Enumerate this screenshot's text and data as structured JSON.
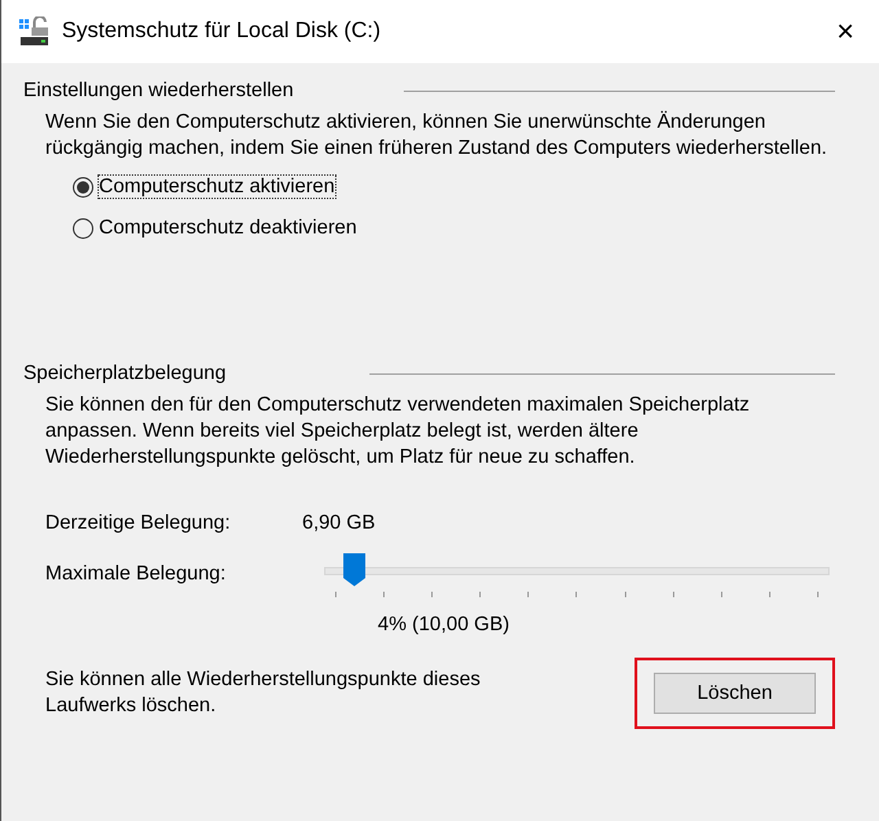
{
  "window": {
    "title": "Systemschutz für Local Disk (C:)",
    "close": "×"
  },
  "restore": {
    "heading": "Einstellungen wiederherstellen",
    "description": "Wenn Sie den Computerschutz aktivieren, können Sie unerwünschte Änderungen rückgängig machen, indem Sie einen früheren Zustand des Computers wiederherstellen.",
    "options": [
      {
        "label": "Computerschutz aktivieren",
        "selected": true
      },
      {
        "label": "Computerschutz deaktivieren",
        "selected": false
      }
    ]
  },
  "disk": {
    "heading": "Speicherplatzbelegung",
    "description": "Sie können den für den Computerschutz verwendeten maximalen Speicherplatz anpassen. Wenn bereits viel Speicherplatz belegt ist, werden ältere Wiederherstellungspunkte gelöscht, um Platz für neue zu schaffen.",
    "current_label": "Derzeitige Belegung:",
    "current_value": "6,90 GB",
    "max_label": "Maximale Belegung:",
    "max_slider": {
      "level": 0.04
    },
    "max_reading": "4% (10,00 GB)",
    "delete_text": "Sie können alle Wiederherstellungspunkte dieses Laufwerks löschen.",
    "delete_button": {
      "label": "Löschen",
      "highlighted": true
    }
  }
}
